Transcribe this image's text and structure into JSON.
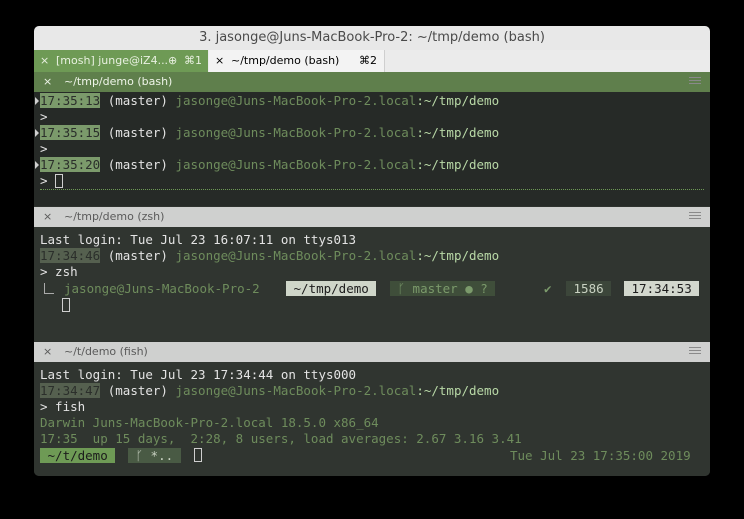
{
  "window": {
    "title": "3. jasonge@Juns-MacBook-Pro-2: ~/tmp/demo (bash)"
  },
  "tabs": [
    {
      "close": "×",
      "label": "[mosh] junge@iZ4...",
      "globe": "⊕",
      "shortcut": "⌘1"
    },
    {
      "close": "×",
      "label": "~/tmp/demo (bash)",
      "shortcut": "⌘2"
    }
  ],
  "panes": {
    "bash": {
      "close": "×",
      "title": "~/tmp/demo (bash)",
      "lines": [
        {
          "time": "17:35:13",
          "branch": " (master) ",
          "host": "jasonge@Juns-MacBook-Pro-2.local",
          "path": ":~/tmp/demo"
        },
        {
          "time": "17:35:15",
          "branch": " (master) ",
          "host": "jasonge@Juns-MacBook-Pro-2.local",
          "path": ":~/tmp/demo"
        },
        {
          "time": "17:35:20",
          "branch": " (master) ",
          "host": "jasonge@Juns-MacBook-Pro-2.local",
          "path": ":~/tmp/demo"
        }
      ],
      "prompt": ">"
    },
    "zsh": {
      "close": "×",
      "title": "~/tmp/demo (zsh)",
      "last_login": "Last login: Tue Jul 23 16:07:11 on ttys013",
      "time": "17:34:46",
      "branch": " (master) ",
      "host": "jasonge@Juns-MacBook-Pro-2.local",
      "path": ":~/tmp/demo",
      "command": "> zsh",
      "prompt_user": "jasonge@Juns-MacBook-Pro-2",
      "prompt_path": " ~/tmp/demo ",
      "prompt_git": " ᚴ master ● ? ",
      "prompt_check": "✔",
      "prompt_count": " 1586 ",
      "prompt_time": " 17:34:53 "
    },
    "fish": {
      "close": "×",
      "title": "~/t/demo (fish)",
      "last_login": "Last login: Tue Jul 23 17:34:44 on ttys000",
      "time": "17:34:47",
      "branch": " (master) ",
      "host": "jasonge@Juns-MacBook-Pro-2.local",
      "path": ":~/tmp/demo",
      "command": "> fish",
      "sysinfo": "Darwin Juns-MacBook-Pro-2.local 18.5.0 x86_64",
      "uptime": "17:35  up 15 days,  2:28, 8 users, load averages: 2.67 3.16 3.41",
      "prompt_path": " ~/t/demo ",
      "prompt_git": " ᚴ *.. ",
      "right_date": "Tue Jul 23 17:35:00 2019"
    }
  },
  "colors": {
    "accent_green": "#6e9a55",
    "timestamp_bg": "#7b9a6b",
    "host_green": "#b8d8a6",
    "terminal_bg": "#2e322e"
  }
}
